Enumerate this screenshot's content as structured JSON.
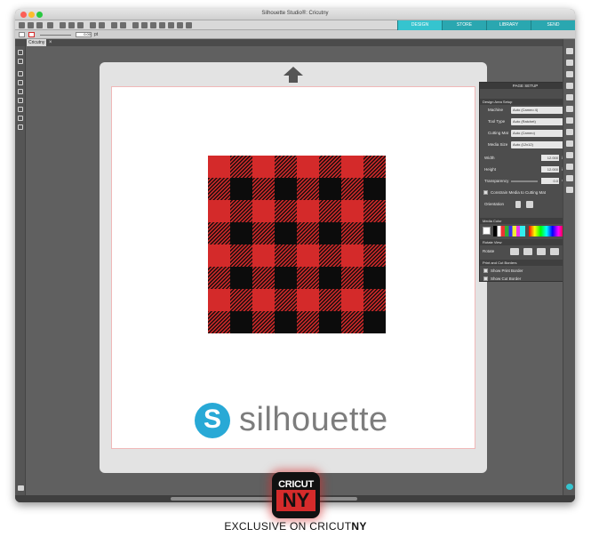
{
  "window": {
    "title": "Silhouette Studio®: Cricutny"
  },
  "nav": {
    "tabs": [
      "DESIGN",
      "STORE",
      "LIBRARY",
      "SEND"
    ],
    "active": "DESIGN"
  },
  "toolbar2": {
    "line_value": "0.00",
    "line_unit": "pt"
  },
  "doc_tab": {
    "label": "Cricutny"
  },
  "panel": {
    "title": "PAGE SETUP",
    "section_design": "Design Area Setup",
    "machine_label": "Machine",
    "machine_value": "Auto (Cameo 4)",
    "tool_label": "Tool Type",
    "tool_value": "Auto (Ratchet)",
    "cutting_mat_label": "Cutting Mat",
    "cutting_mat_value": "Auto (Cameo)",
    "media_size_label": "Media Size",
    "media_size_value": "Auto (12x12)",
    "width_label": "Width",
    "width_value": "12.000",
    "width_unit": "in",
    "height_label": "Height",
    "height_value": "12.000",
    "height_unit": "in",
    "transparency_label": "Transparency",
    "transparency_value": "0.0",
    "transparency_unit": "%",
    "constrain_label": "Constrain Media to Cutting Mat",
    "orientation_label": "Orientation",
    "media_color_label": "Media Color",
    "rotate_view_label": "Rotate View",
    "rotate_label": "Rotate",
    "print_cut_label": "Print and Cut Borders",
    "show_print_border": "Show Print Border",
    "show_cut_border": "Show Cut Border"
  },
  "logo": {
    "text": "silhouette",
    "mark": "S"
  },
  "badge": {
    "top": "CRICUT",
    "bottom": "NY"
  },
  "caption": {
    "prefix": "EXCLUSIVE ON CRICUT",
    "suffix": "NY"
  },
  "colors": {
    "plaid_red": "#d42a2a",
    "plaid_black": "#0c0c0c",
    "accent_teal": "#2aa7b0",
    "logo_blue": "#28a9d6"
  }
}
